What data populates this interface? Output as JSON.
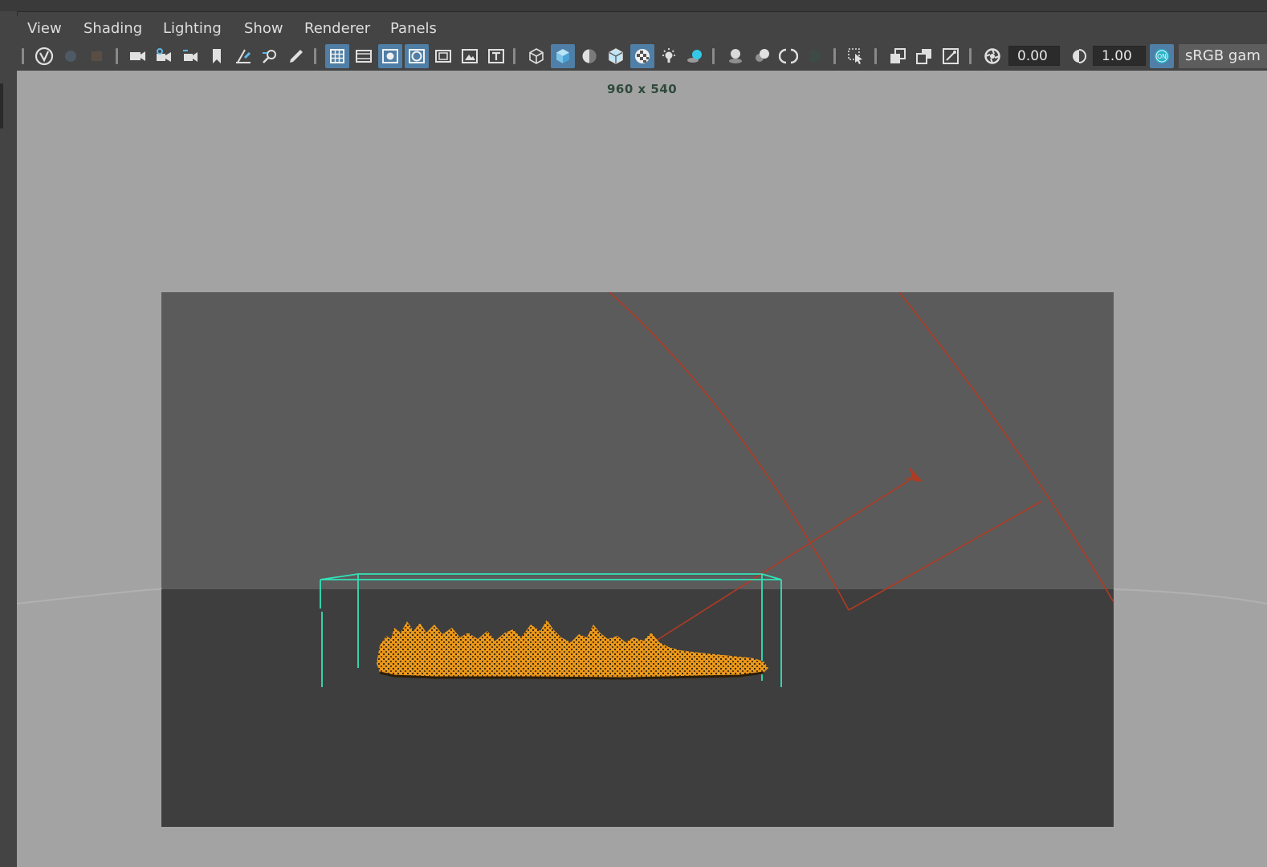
{
  "menu": {
    "items": [
      {
        "label": "View"
      },
      {
        "label": "Shading"
      },
      {
        "label": "Lighting"
      },
      {
        "label": "Show"
      },
      {
        "label": "Renderer"
      },
      {
        "label": "Panels"
      }
    ]
  },
  "toolbar": {
    "exposure_value": "0.00",
    "gamma_value": "1.00",
    "color_management_badge": "ON",
    "color_space_label": "sRGB gam"
  },
  "viewport": {
    "resolution_label": "960 x 540"
  },
  "colors": {
    "accent": "#4f7fa6",
    "bounding_box": "#31e3b8",
    "light_manipulator": "#b23a22",
    "fluid": "#e8961a"
  }
}
